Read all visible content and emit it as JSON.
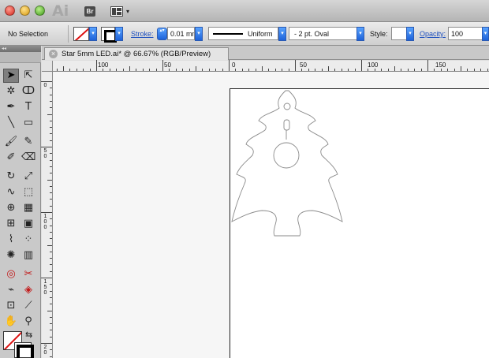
{
  "window": {
    "app_logo": "Ai",
    "bridge_label": "Br",
    "arrange_arrow": "▾"
  },
  "control_bar": {
    "selection_label": "No Selection",
    "stroke_label": "Stroke:",
    "stroke_weight": "0.01 mm",
    "profile_label": "Uniform",
    "brush_label": "-   2 pt. Oval",
    "style_label": "Style:",
    "opacity_label": "Opacity:",
    "opacity_value": "100",
    "dropdown_arrow": "▾",
    "stepper_glyph": "▴▾"
  },
  "tools": {
    "grip": "◂◂",
    "items": [
      {
        "name": "selection-tool",
        "glyph": "➤",
        "selected": true
      },
      {
        "name": "direct-selection-tool",
        "glyph": "⇱"
      },
      {
        "name": "magic-wand-tool",
        "glyph": "✲"
      },
      {
        "name": "lasso-tool",
        "glyph": "ↀ"
      },
      {
        "name": "pen-tool",
        "glyph": "✒"
      },
      {
        "name": "type-tool",
        "glyph": "T"
      },
      {
        "name": "line-segment-tool",
        "glyph": "╲"
      },
      {
        "name": "rectangle-tool",
        "glyph": "▭"
      },
      {
        "name": "paintbrush-tool",
        "glyph": "🖌"
      },
      {
        "name": "pencil-tool",
        "glyph": "✎"
      },
      {
        "name": "blob-brush-tool",
        "glyph": "✐"
      },
      {
        "name": "eraser-tool",
        "glyph": "⌫"
      },
      {
        "name": "rotate-tool",
        "glyph": "↻"
      },
      {
        "name": "scale-tool",
        "glyph": "⤢"
      },
      {
        "name": "warp-tool",
        "glyph": "∿"
      },
      {
        "name": "free-transform-tool",
        "glyph": "⬚"
      },
      {
        "name": "shape-builder-tool",
        "glyph": "⊕"
      },
      {
        "name": "perspective-grid-tool",
        "glyph": "▦"
      },
      {
        "name": "mesh-tool",
        "glyph": "⊞"
      },
      {
        "name": "gradient-tool",
        "glyph": "▣"
      },
      {
        "name": "eyedropper-tool",
        "glyph": "⌇"
      },
      {
        "name": "blend-tool",
        "glyph": "⁘"
      },
      {
        "name": "symbol-sprayer-tool",
        "glyph": "✺"
      },
      {
        "name": "column-graph-tool",
        "glyph": "▥"
      },
      {
        "name": "artboard-tool",
        "glyph": "◎",
        "red": true
      },
      {
        "name": "slice-tool",
        "glyph": "✂",
        "red": true
      },
      {
        "name": "eraser-path-tool",
        "glyph": "⌁"
      },
      {
        "name": "live-paint-tool",
        "glyph": "◈",
        "red": true
      },
      {
        "name": "crop-area-tool",
        "glyph": "⊡"
      },
      {
        "name": "knife-tool",
        "glyph": "⟋"
      },
      {
        "name": "hand-tool",
        "glyph": "✋"
      },
      {
        "name": "zoom-tool",
        "glyph": "⚲"
      }
    ],
    "swap_glyph": "⇆"
  },
  "document": {
    "close_glyph": "×",
    "tab_title": "Star 5mm LED.ai* @ 66.67% (RGB/Preview)"
  },
  "ruler": {
    "h_labels": [
      "100",
      "50",
      "0",
      "50",
      "100",
      "150"
    ],
    "v_labels": [
      "0",
      "5\n0",
      "1\n0\n0",
      "1\n5\n0",
      "2\n0"
    ]
  },
  "colors": {
    "accent": "#1d62d9",
    "link": "#1d4fbf",
    "fill_none_slash": "#d11111",
    "artwork_stroke": "#8a8a8a"
  }
}
